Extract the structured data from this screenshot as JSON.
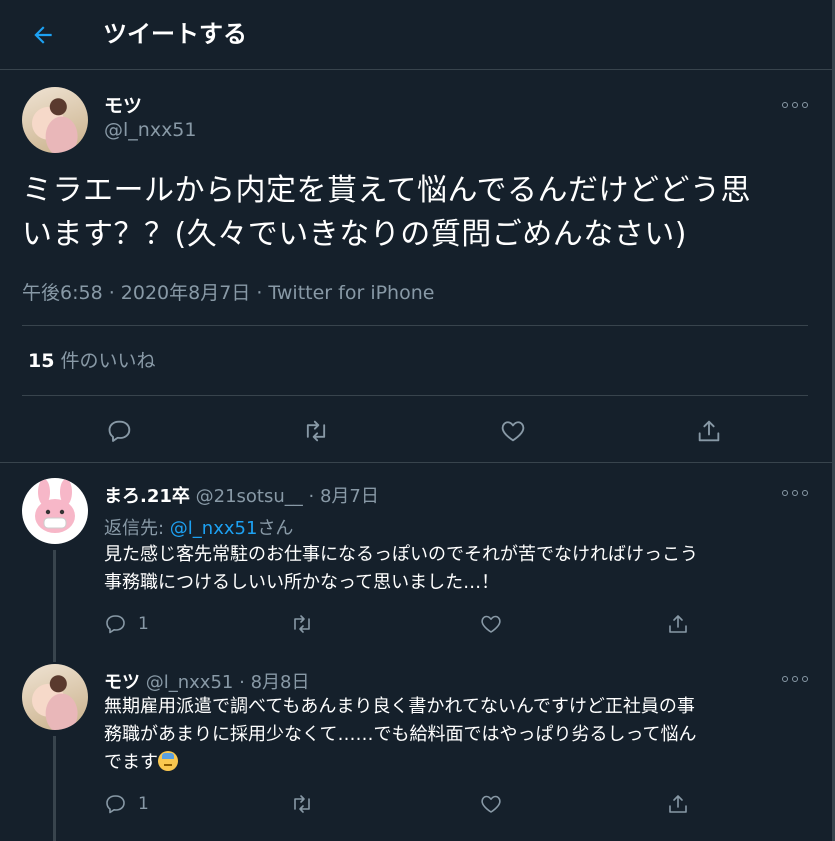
{
  "header": {
    "title": "ツイートする"
  },
  "main_tweet": {
    "name": "モツ",
    "handle": "@l_nxx51",
    "text_line1": "ミラエールから内定を貰えて悩んでるんだけどどう思",
    "text_line2": "います？？(久々でいきなりの質問ごめんなさい)",
    "meta": "午後6:58 · 2020年8月7日 · Twitter for iPhone",
    "likes_count": "15",
    "likes_label": "件のいいね"
  },
  "replies": [
    {
      "name": "まろ.21卒",
      "handle": "@21sotsu__",
      "sep": "·",
      "date": "8月7日",
      "reply_to_prefix": "返信先: ",
      "reply_to_handle": "@l_nxx51",
      "reply_to_suffix": "さん",
      "text_line1": "見た感じ客先常駐のお仕事になるっぽいのでそれが苦でなければけっこう",
      "text_line2": "事務職につけるしいい所かなって思いました…！",
      "reply_count": "1"
    },
    {
      "name": "モツ",
      "handle": "@l_nxx51",
      "sep": "·",
      "date": "8月8日",
      "text_line1": "無期雇用派遣で調べてもあんまり良く書かれてないんですけど正社員の事",
      "text_line2": "務職があまりに採用少なくて……でも給料面ではやっぱり劣るしって悩ん",
      "text_line3": "でます",
      "emoji": "downcast-face-with-sweat",
      "reply_count": "1"
    }
  ],
  "colors": {
    "background": "#15202b",
    "accent": "#1da1f2",
    "secondary_text": "#8899a6",
    "divider": "#38444d"
  }
}
